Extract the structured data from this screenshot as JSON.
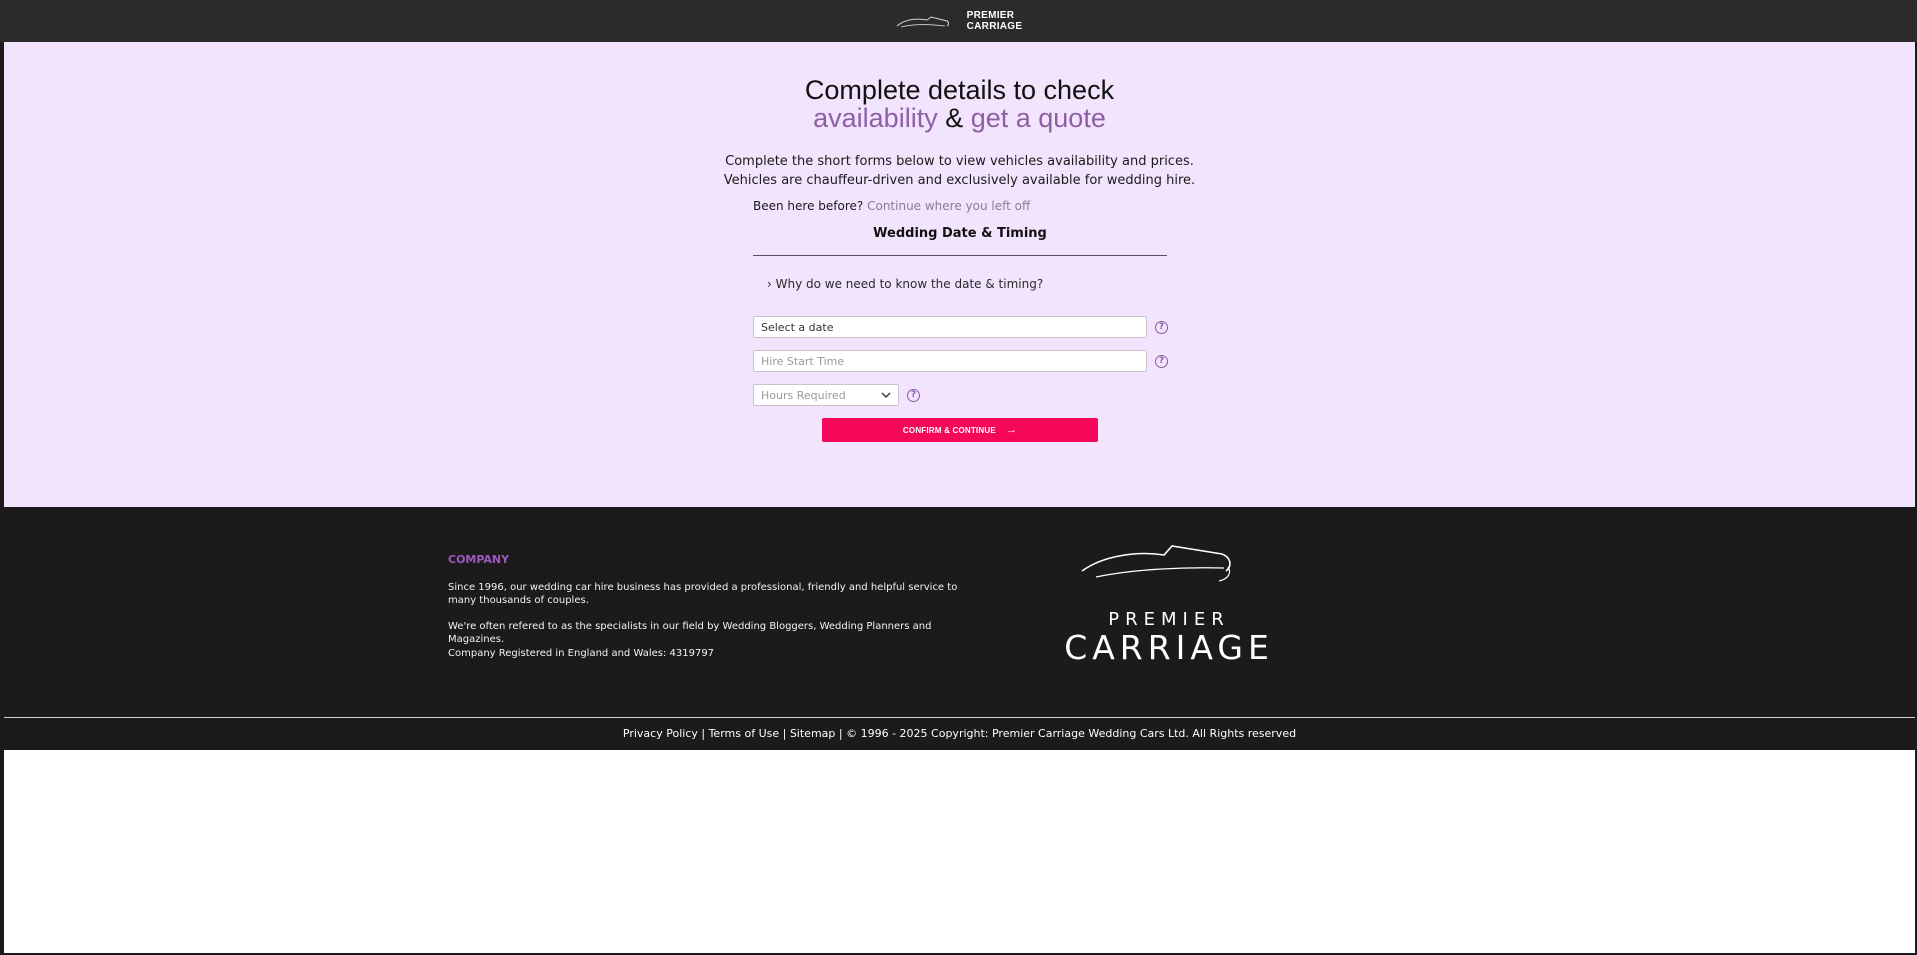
{
  "header": {
    "brand_line1": "PREMIER",
    "brand_line2": "CARRIAGE",
    "logo_icon": "car-silhouette-icon"
  },
  "main": {
    "headline_line1": "Complete details to check",
    "headline_accent1": "availability",
    "headline_and": " & ",
    "headline_accent2": "get a quote",
    "intro_line1": "Complete the short forms below to view vehicles availability and prices.",
    "intro_line2": "Vehicles are chauffeur-driven and exclusively available for wedding hire.",
    "returning_prefix": "Been here before?",
    "returning_link": "Continue where you left off",
    "section_title": "Wedding Date & Timing",
    "why_text": "› Why do we need to know the date & timing?",
    "date_value": "Select a date",
    "time_placeholder": "Hire Start Time",
    "hours_placeholder": "Hours Required",
    "help_glyph": "?",
    "confirm_label": "CONFIRM & CONTINUE",
    "confirm_arrow": "→",
    "accent_color": "#8f5ea5",
    "button_color": "#f5075a"
  },
  "footer": {
    "company_title": "COMPANY",
    "company_p1": "Since 1996, our wedding car hire business has provided a professional, friendly and helpful service to many thousands of couples.",
    "company_p2": "We're often refered to as the specialists in our field by Wedding Bloggers, Wedding Planners and Magazines.",
    "company_p3": "Company Registered in England and Wales: 4319797",
    "logo_line1": "PREMIER",
    "logo_line2": "CARRIAGE",
    "privacy": "Privacy Policy",
    "terms": "Terms of Use",
    "sitemap": "Sitemap",
    "separator": " | ",
    "copyright": "© 1996 - 2025 Copyright: Premier Carriage Wedding Cars Ltd. All Rights reserved"
  }
}
